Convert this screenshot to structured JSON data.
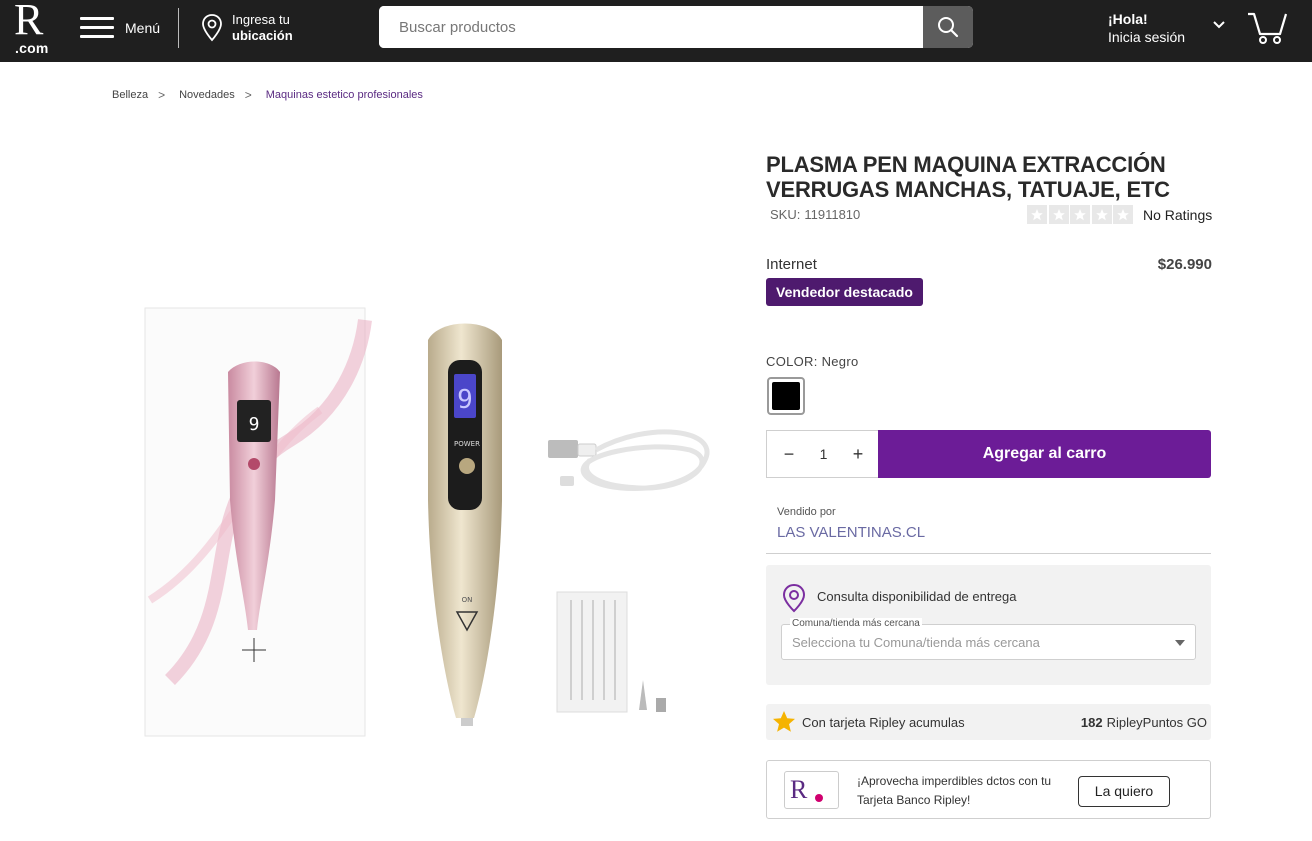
{
  "header": {
    "logo_letter": "R",
    "logo_domain": ".com",
    "menu_label": "Menú",
    "location_line1": "Ingresa tu",
    "location_line2": "ubicación",
    "search_placeholder": "Buscar productos",
    "greeting": "¡Hola!",
    "login_label": "Inicia sesión"
  },
  "breadcrumb": [
    {
      "label": "Belleza"
    },
    {
      "label": "Novedades"
    },
    {
      "label": "Maquinas estetico profesionales"
    }
  ],
  "product": {
    "title": "PLASMA PEN MAQUINA EXTRACCIÓN VERRUGAS MANCHAS, TATUAJE, ETC",
    "sku_label": "SKU:",
    "sku_value": "11911810",
    "rating_stars": 0,
    "ratings_text": "No Ratings",
    "price_label": "Internet",
    "price": "$26.990",
    "badge": "Vendedor destacado",
    "color_label": "COLOR:",
    "color_value": "Negro",
    "quantity": "1",
    "minus": "−",
    "plus": "+",
    "add_to_cart": "Agregar al carro",
    "sold_by_label": "Vendido por",
    "seller": "LAS VALENTINAS.CL",
    "image_lcd_digit": "9",
    "image_power_label": "POWER",
    "image_on_label": "ON"
  },
  "delivery": {
    "title": "Consulta disponibilidad de entrega",
    "select_legend": "Comuna/tienda más cercana",
    "select_placeholder": "Selecciona tu Comuna/tienda más cercana"
  },
  "points": {
    "text": "Con tarjeta Ripley acumulas",
    "value": "182",
    "unit": "RipleyPuntos GO"
  },
  "promo": {
    "card_letter": "R",
    "text": "¡Aprovecha imperdibles dctos con tu Tarjeta Banco Ripley!",
    "button": "La quiero"
  },
  "colors": {
    "header_bg": "#1f1f1f",
    "brand_purple": "#6c1c97",
    "badge_purple": "#4e1a6e",
    "star_yellow": "#f5b301",
    "pin_purple": "#7b2ea0"
  }
}
